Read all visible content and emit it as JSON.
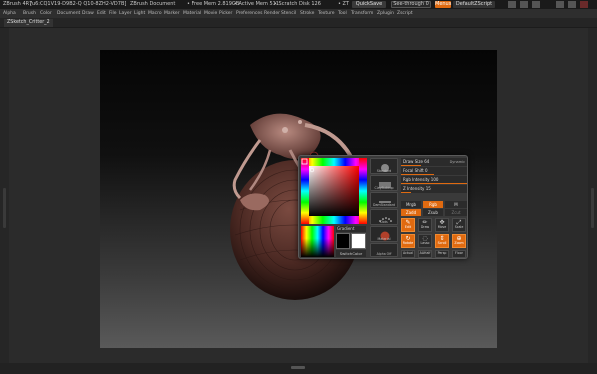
{
  "titlebar": {
    "app": "ZBrush 4R7",
    "code": "[u6:CQ1V19-D9B2-Q Q10-8ZH2-VD7B]",
    "document": "ZBrush Document",
    "free_mem": "• Free Mem 2.819GB",
    "active_mem": "• Active Mem 511",
    "scratch": "• Scratch Disk 126",
    "extra": "• ZT",
    "quicksave": "QuickSave",
    "see_through": "See-through  0",
    "menus": "Menus",
    "default_zscript": "DefaultZScript"
  },
  "menubar": [
    "Alpha",
    "Brush",
    "Color",
    "Document",
    "Draw",
    "Edit",
    "File",
    "Layer",
    "Light",
    "Macro",
    "Marker",
    "Material",
    "Movie",
    "Picker",
    "Preferences",
    "Render",
    "Stencil",
    "Stroke",
    "Texture",
    "Tool",
    "Transform",
    "Zplugin",
    "Zscript"
  ],
  "tabbar": {
    "active_tool": "ZSketch_Critter_2"
  },
  "popup": {
    "gradient_label": "Gradient",
    "switch_color_label": "SwitchColor",
    "brushes": [
      "Standard",
      "ClayBuildup",
      "DamStandard",
      "Dots",
      "Material",
      "Alpha Off"
    ],
    "sliders": [
      {
        "label": "Draw Size 64",
        "level": 0.3
      },
      {
        "label": "Focal Shift 0",
        "level": 0.5
      },
      {
        "label": "Rgb Intensity 100",
        "level": 1.0
      },
      {
        "label": "Z Intensity 15",
        "level": 0.15
      }
    ],
    "dynamic_label": "Dynamic",
    "mrgb": [
      "Mrgb",
      "Rgb",
      "M"
    ],
    "zadd": [
      "Zadd",
      "Zsub",
      "Zcut"
    ],
    "tools": [
      "Edit",
      "Draw",
      "Move",
      "Scale",
      "Rotate",
      "Lasso",
      "Scroll",
      "Zoom",
      "Actual",
      "AAHalf",
      "Persp",
      "Floor",
      "Local",
      "Frame"
    ]
  },
  "colors": {
    "accent": "#e06a10",
    "canvas_top": "#050505",
    "canvas_bottom": "#5a5a5a",
    "primary_color": "#000000",
    "secondary_color": "#ffffff"
  }
}
